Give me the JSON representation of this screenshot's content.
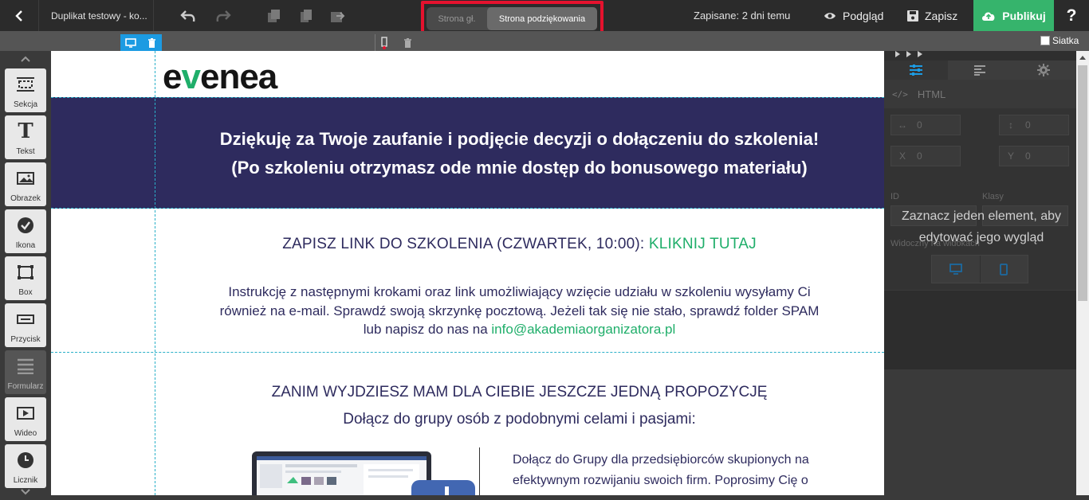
{
  "topbar": {
    "back_icon": "chevron-left-icon",
    "doc_title": "Duplikat testowy - ko...",
    "undo_icon": "undo-icon",
    "redo_icon": "redo-icon",
    "tabs": [
      {
        "label": "Strona gł."
      },
      {
        "label": "Strona podziękowania"
      }
    ],
    "saved_status": "Zapisane: 2 dni temu",
    "preview_label": "Podgląd",
    "save_label": "Zapisz",
    "publish_label": "Publikuj",
    "help_label": "?"
  },
  "subbar": {
    "grid_label": "Siatka"
  },
  "sidebar": {
    "items": [
      {
        "label": "Sekcja",
        "icon": "section-icon"
      },
      {
        "label": "Tekst",
        "icon": "text-icon"
      },
      {
        "label": "Obrazek",
        "icon": "image-icon"
      },
      {
        "label": "Ikona",
        "icon": "check-circle-icon"
      },
      {
        "label": "Box",
        "icon": "box-icon"
      },
      {
        "label": "Przycisk",
        "icon": "button-icon"
      },
      {
        "label": "Formularz",
        "icon": "form-icon"
      },
      {
        "label": "Wideo",
        "icon": "video-icon"
      },
      {
        "label": "Licznik",
        "icon": "clock-icon"
      }
    ]
  },
  "canvas": {
    "logo_text_a": "e",
    "logo_text_v": "v",
    "logo_text_b": "enea",
    "banner_line1": "Dziękuję za Twoje zaufanie i podjęcie decyzji o dołączeniu do szkolenia!",
    "banner_line2": "(Po szkoleniu otrzymasz ode mnie dostęp do bonusowego materiału)",
    "save_link_text": "ZAPISZ LINK DO SZKOLENIA (CZWARTEK, 10:00): ",
    "save_link_cta": "KLIKNIJ TUTAJ",
    "instructions": "Instrukcję z następnymi krokami oraz link umożliwiający wzięcie udziału w szkoleniu wysyłamy Ci również na e-mail. Sprawdź swoją skrzynkę pocztową. Jeżeli tak się nie stało, sprawdź folder SPAM lub napisz do nas na ",
    "email": "info@akademiaorganizatora.pl",
    "before_heading": "ZANIM WYJDZIESZ MAM DLA CIEBIE JESZCZE JEDNĄ PROPOZYCJĘ",
    "join_subheading": "Dołącz do grupy osób z podobnymi celami i pasjami:",
    "group_text": "Dołącz do Grupy dla przedsiębiorców skupionych na efektywnym rozwijaniu swoich firm. Poprosimy Cię o"
  },
  "right_panel": {
    "html_label": "HTML",
    "width_value": "0",
    "height_value": "0",
    "x_label": "X",
    "x_value": "0",
    "y_label": "Y",
    "y_value": "0",
    "id_label": "ID",
    "classes_label": "Klasy",
    "visible_label": "Widoczny na widokach",
    "overlay_text": "Zaznacz jeden element, aby edytować jego wygląd"
  },
  "colors": {
    "accent_blue": "#1c9be2",
    "publish_green": "#36b46c",
    "brand_navy": "#2e2b5e",
    "brand_green": "#1fae6a",
    "highlight_red": "#e5122e"
  }
}
